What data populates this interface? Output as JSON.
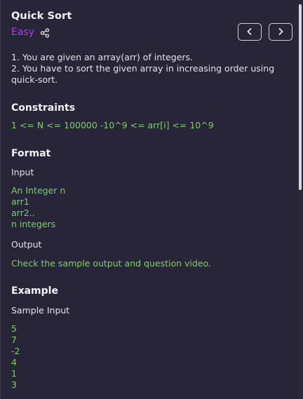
{
  "problem": {
    "title": "Quick Sort",
    "difficulty": "Easy",
    "description": [
      "1. You are given an array(arr) of integers.",
      "2. You have to sort the given array in increasing order using quick-sort."
    ]
  },
  "constraints": {
    "heading": "Constraints",
    "text": "1 <= N <= 100000 -10^9 <= arr[i] <= 10^9"
  },
  "format": {
    "heading": "Format",
    "input_label": "Input",
    "input_lines": [
      "An Integer n",
      "arr1",
      "arr2..",
      "n integers"
    ],
    "output_label": "Output",
    "output_text": "Check the sample output and question video."
  },
  "example": {
    "heading": "Example",
    "sample_input_label": "Sample Input",
    "sample_input_lines": [
      "5",
      "7",
      "-2",
      "4",
      "1",
      "3"
    ]
  },
  "icons": {
    "share": "share-icon",
    "prev": "chevron-left-icon",
    "next": "chevron-right-icon"
  },
  "colors": {
    "background": "#272537",
    "difficulty_easy": "#a642ea",
    "code_green": "#7fcf6a"
  }
}
